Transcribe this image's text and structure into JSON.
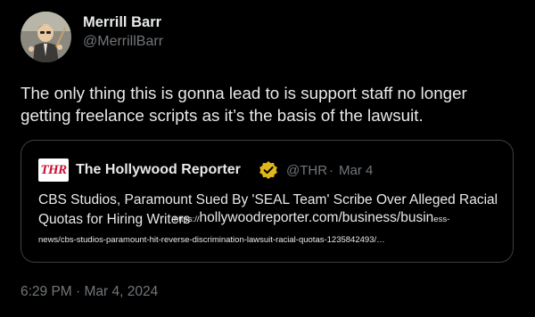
{
  "author": {
    "name": "Merrill Barr",
    "handle": "@MerrillBarr",
    "avatar_icon": "cartoon-avatar-icon"
  },
  "tweet": {
    "text": "The only thing this is gonna lead to is support staff no longer getting freelance scripts as it’s the basis of the lawsuit.",
    "timestamp": "6:29 PM · Mar 4, 2024"
  },
  "quote": {
    "logo_text": "THR",
    "name": "The Hollywood Reporter",
    "verified_icon": "verified-gold-badge-icon",
    "handle": "@THR",
    "separator": "·",
    "date": "Mar 4",
    "headline": "CBS Studios, Paramount Sued By 'SEAL Team' Scribe Over Alleged Racial Quotas for Hiring Writers",
    "url_prefix": "https://",
    "url_main": "hollywoodreporter.com/business/busin",
    "url_tail": "ess-",
    "url_line2": "news/cbs-studios-paramount-hit-reverse-discrimination-lawsuit-racial-quotas-1235842493/…"
  },
  "colors": {
    "background": "#000000",
    "text": "#e7e9ea",
    "muted": "#71767b",
    "card_border": "#3a3f44",
    "thr_red": "#c8102e",
    "verified_gold": "#e2b719"
  }
}
